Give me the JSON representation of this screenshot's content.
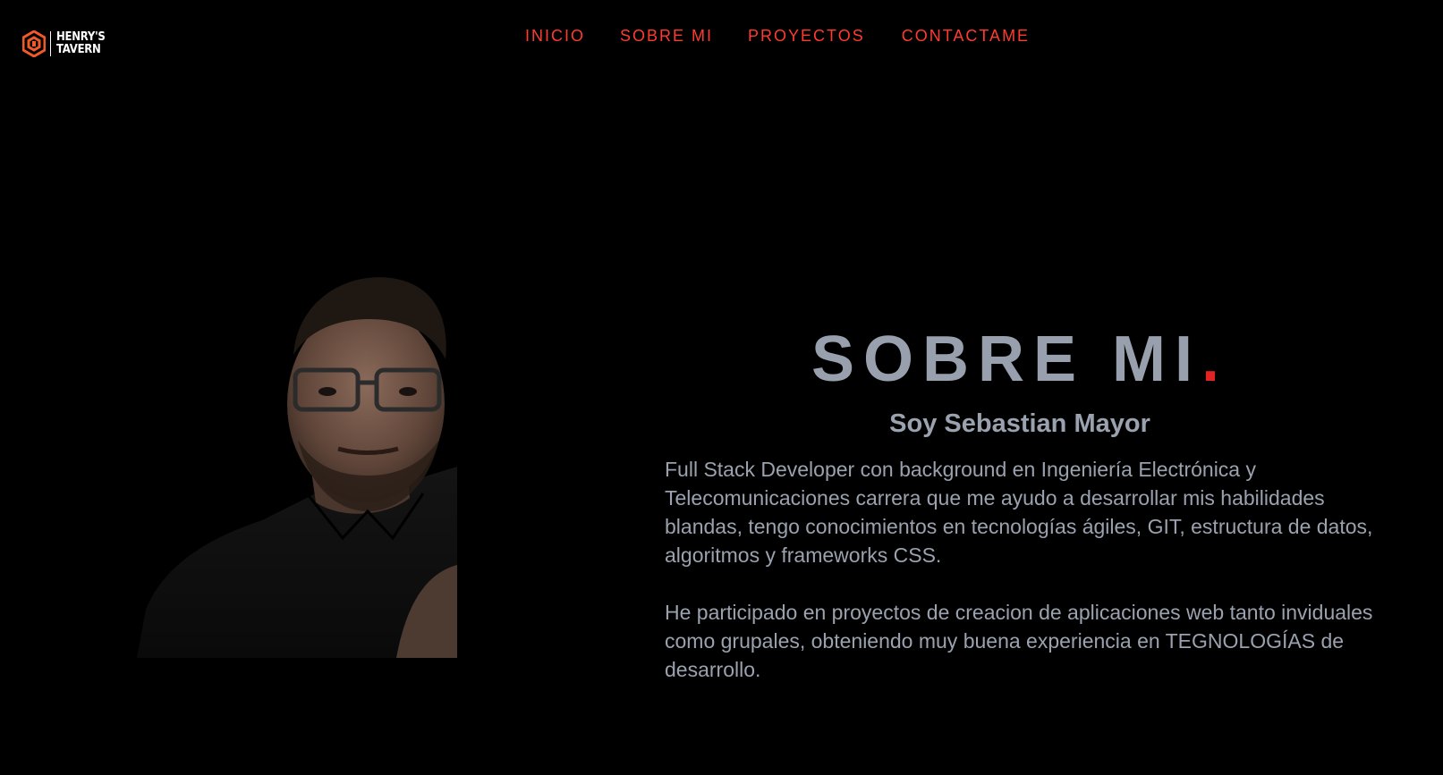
{
  "header": {
    "logo": {
      "line1": "HENRY'S",
      "line2": "TAVERN",
      "icon": "henrys-tavern-logo-icon",
      "color": "#f05a28"
    },
    "nav": [
      {
        "label": "INICIO"
      },
      {
        "label": "SOBRE MI"
      },
      {
        "label": "PROYECTOS"
      },
      {
        "label": "CONTACTAME"
      }
    ],
    "nav_color": "#ff3b30"
  },
  "about": {
    "title": "SOBRE MI",
    "title_dot": ".",
    "subtitle": "Soy Sebastian Mayor",
    "paragraphs": [
      "Full Stack Developer con background en Ingeniería Electrónica y Telecomunicaciones carrera que me ayudo a desarrollar mis habilidades blandas, tengo conocimientos en tecnologías ágiles, GIT, estructura de datos, algoritmos y frameworks CSS.",
      "He participado en proyectos de creacion de aplicaciones web tanto inviduales como grupales, obteniendo muy buena experiencia en TEGNOLOGÍAS de desarrollo."
    ],
    "text_color": "#9aa2af",
    "accent_color": "#e02424"
  },
  "portrait": {
    "icon": "profile-photo"
  },
  "colors": {
    "background": "#000000"
  }
}
